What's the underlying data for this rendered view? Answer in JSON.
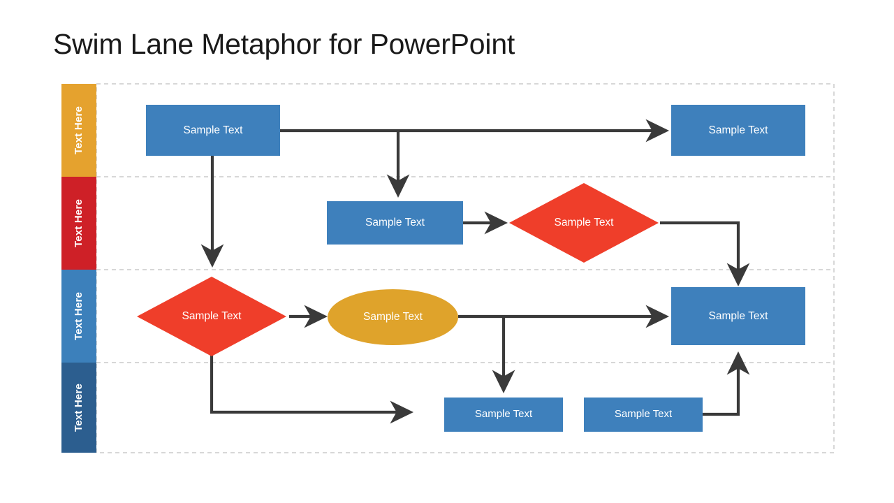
{
  "slide": {
    "title": "Swim Lane Metaphor for PowerPoint",
    "background_color": "#FFFFFF",
    "title_color": "#1A1A1A"
  },
  "palette": {
    "lane_amber": "#E5A22E",
    "lane_red": "#CE2027",
    "lane_blue": "#3C80BB",
    "lane_dark_blue": "#2C5E8F",
    "shape_blue": "#3E80BC",
    "shape_red": "#EF3E2A",
    "shape_amber": "#DFA32B",
    "connector": "#3A3A3A",
    "lane_divider": "#BFBFBF",
    "shape_text": "#FFFFFF"
  },
  "lanes": [
    {
      "label": "Text Here",
      "color": "#E5A22E",
      "name": "lane-1"
    },
    {
      "label": "Text Here",
      "color": "#CE2027",
      "name": "lane-2"
    },
    {
      "label": "Text Here",
      "color": "#3C80BB",
      "name": "lane-3"
    },
    {
      "label": "Text Here",
      "color": "#2C5E8F",
      "name": "lane-4"
    }
  ],
  "nodes": [
    {
      "id": "n1",
      "lane": 1,
      "shape": "rect",
      "label": "Sample Text"
    },
    {
      "id": "n2",
      "lane": 1,
      "shape": "rect",
      "label": "Sample Text"
    },
    {
      "id": "n3",
      "lane": 2,
      "shape": "rect",
      "label": "Sample Text"
    },
    {
      "id": "n4",
      "lane": 2,
      "shape": "diamond",
      "label": "Sample Text"
    },
    {
      "id": "n5",
      "lane": 3,
      "shape": "diamond",
      "label": "Sample Text"
    },
    {
      "id": "n6",
      "lane": 3,
      "shape": "ellipse",
      "label": "Sample Text"
    },
    {
      "id": "n7",
      "lane": 3,
      "shape": "rect",
      "label": "Sample Text"
    },
    {
      "id": "n8",
      "lane": 4,
      "shape": "rect",
      "label": "Sample Text"
    },
    {
      "id": "n9",
      "lane": 4,
      "shape": "rect",
      "label": "Sample Text"
    }
  ],
  "connectors": [
    {
      "from": "n1",
      "to": "n2",
      "style": "horizontal-arrow"
    },
    {
      "from": "n1",
      "to": "n3",
      "style": "branch-down-arrow"
    },
    {
      "from": "n1",
      "to": "n5",
      "style": "vertical-arrow"
    },
    {
      "from": "n3",
      "to": "n4",
      "style": "short-horizontal-arrow"
    },
    {
      "from": "n4",
      "to": "n7",
      "style": "elbow-right-down-arrow"
    },
    {
      "from": "n5",
      "to": "n6",
      "style": "short-horizontal-arrow"
    },
    {
      "from": "n5",
      "to": "n8",
      "style": "elbow-down-right-arrow"
    },
    {
      "from": "n6",
      "to": "n7",
      "style": "horizontal-arrow"
    },
    {
      "from": "n6",
      "to": "n8",
      "style": "branch-down-arrow"
    },
    {
      "from": "n9",
      "to": "n7",
      "style": "elbow-right-up-arrow"
    }
  ]
}
